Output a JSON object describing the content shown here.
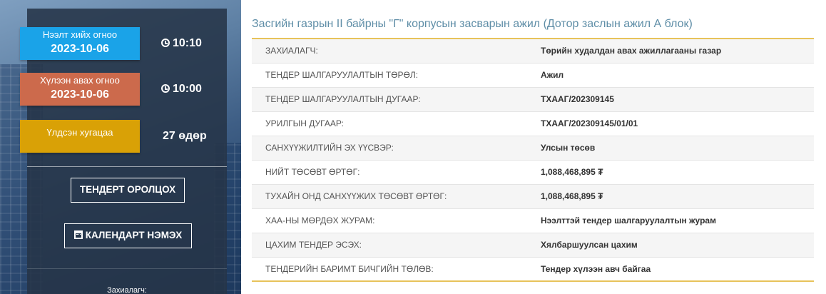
{
  "sidebar": {
    "open_date": {
      "label": "Нээлт хийх огноо",
      "date": "2023-10-06",
      "time": "10:10",
      "icon": "clock-icon",
      "color": "#1aa3e8"
    },
    "receive_date": {
      "label": "Хүлээн авах огноо",
      "date": "2023-10-06",
      "time": "10:00",
      "icon": "clock-icon",
      "color": "#cc6a4c"
    },
    "remaining": {
      "label": "Үлдсэн хугацаа",
      "value": "27 өдөр",
      "color": "#d9a106"
    },
    "participate_button": "ТЕНДЕРТ ОРОЛЦОХ",
    "calendar_button": {
      "label": "КАЛЕНДАРТ НЭМЭХ",
      "icon": "calendar-icon"
    },
    "customer_caption": "Захиалагч:"
  },
  "main": {
    "title": "Засгийн газрын II байрны \"Г\" корпусын засварын ажил (Дотор заслын ажил А блок)",
    "rows": [
      {
        "key": "ЗАХИАЛАГЧ:",
        "value": "Төрийн худалдан авах ажиллагааны газар"
      },
      {
        "key": "ТЕНДЕР ШАЛГАРУУЛАЛТЫН ТӨРӨЛ:",
        "value": "Ажил"
      },
      {
        "key": "ТЕНДЕР ШАЛГАРУУЛАЛТЫН ДУГААР:",
        "value": "ТХААГ/202309145"
      },
      {
        "key": "УРИЛГЫН ДУГААР:",
        "value": "ТХААГ/202309145/01/01"
      },
      {
        "key": "САНХҮҮЖИЛТИЙН ЭХ ҮҮСВЭР:",
        "value": "Улсын төсөв"
      },
      {
        "key": "НИЙТ ТӨСӨВТ ӨРТӨГ:",
        "value": "1,088,468,895 ₮"
      },
      {
        "key": "ТУХАЙН ОНД САНХҮҮЖИХ ТӨСӨВТ ӨРТӨГ:",
        "value": "1,088,468,895 ₮"
      },
      {
        "key": "ХАА-НЫ МӨРДӨХ ЖУРАМ:",
        "value": "Нээлттэй тендер шалгаруулалтын журам"
      },
      {
        "key": "ЦАХИМ ТЕНДЕР ЭСЭХ:",
        "value": "Хялбаршуулсан цахим"
      },
      {
        "key": "ТЕНДЕРИЙН БАРИМТ БИЧГИЙН ТӨЛӨВ:",
        "value": "Тендер хүлээн авч байгаа"
      }
    ]
  },
  "colors": {
    "title": "#5f8ea7",
    "table_border": "#e7c35a",
    "panel": "#263448"
  }
}
